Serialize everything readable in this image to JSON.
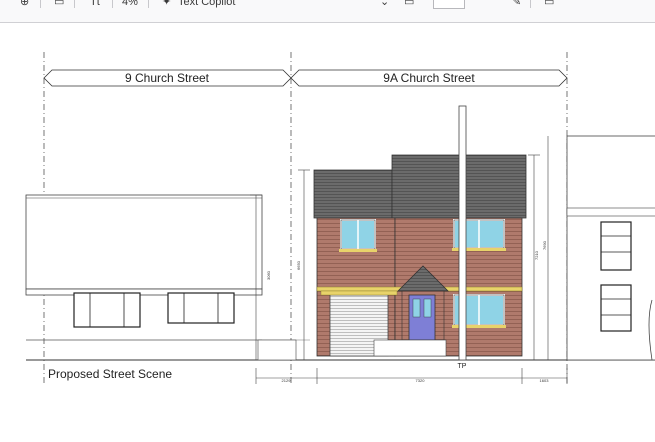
{
  "toolbar": {
    "zoom_label": "4%",
    "text_tool_label": "Text Copilot"
  },
  "drawing": {
    "label_left": "9 Church Street",
    "label_right": "9A Church Street",
    "caption": "Proposed Street Scene",
    "tp_label": "TP",
    "dim_bottom_1": "2129",
    "dim_bottom_2": "7320",
    "dim_bottom_3": "1603",
    "dim_v_bungalow": "3060",
    "dim_v_house_left": "6650",
    "dim_v_house_right": "7210",
    "dim_v_far_right": "7690"
  },
  "colors": {
    "brick": "#b07a6c",
    "brick_line": "#8c5a4e",
    "roof": "#6b6b6b",
    "window_glass": "#8fd3e6",
    "door": "#7e7fd6",
    "stone": "#e8d36a"
  }
}
